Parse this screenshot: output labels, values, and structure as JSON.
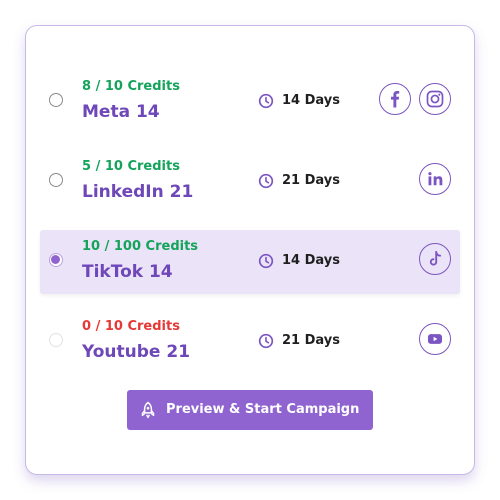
{
  "campaigns": [
    {
      "credits": "8 / 10 Credits",
      "credits_color": "#14a35b",
      "name": "Meta 14",
      "duration": "14 Days",
      "selected": false,
      "platforms": [
        "facebook-icon",
        "instagram-icon"
      ]
    },
    {
      "credits": "5 / 10 Credits",
      "credits_color": "#14a35b",
      "name": "LinkedIn 21",
      "duration": "21 Days",
      "selected": false,
      "platforms": [
        "linkedin-icon"
      ]
    },
    {
      "credits": "10 / 100 Credits",
      "credits_color": "#14a35b",
      "name": "TikTok 14",
      "duration": "14 Days",
      "selected": true,
      "platforms": [
        "tiktok-icon"
      ]
    },
    {
      "credits": "0 / 10 Credits",
      "credits_color": "#e53935",
      "name": "Youtube 21",
      "duration": "21 Days",
      "selected": false,
      "platforms": [
        "youtube-icon"
      ]
    }
  ],
  "cta": {
    "label": "Preview & Start Campaign",
    "icon": "rocket-icon"
  },
  "colors": {
    "accent": "#9064d0",
    "title": "#6e47b8",
    "selected_row": "#ebe3f7",
    "ok": "#14a35b",
    "danger": "#e53935"
  }
}
